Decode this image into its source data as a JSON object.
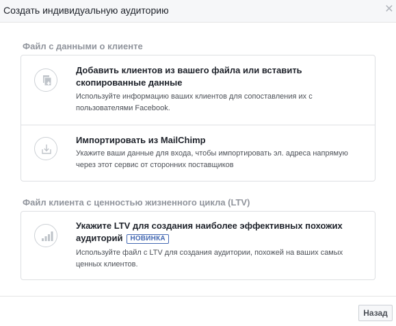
{
  "dialog": {
    "title": "Создать индивидуальную аудиторию",
    "close_icon": "close-icon"
  },
  "sections": [
    {
      "title": "Файл с данными о клиенте",
      "options": [
        {
          "icon": "copy-add-icon",
          "title": "Добавить клиентов из вашего файла или вставить скопированные данные",
          "description": "Используйте информацию ваших клиентов для сопоставления их с пользователями Facebook."
        },
        {
          "icon": "import-icon",
          "title": "Импортировать из MailChimp",
          "description": "Укажите ваши данные для входа, чтобы импортировать эл. адреса напрямую через этот сервис от сторонних поставщиков"
        }
      ]
    },
    {
      "title": "Файл клиента с ценностью жизненного цикла (LTV)",
      "options": [
        {
          "icon": "bar-chart-icon",
          "title": "Укажите LTV для создания наиболее эффективных похожих аудиторий",
          "badge": "НОВИНКА",
          "description": "Используйте файл с LTV для создания аудитории, похожей на ваших самых ценных клиентов."
        }
      ]
    }
  ],
  "footer": {
    "back_label": "Назад"
  },
  "colors": {
    "accent": "#4267b2",
    "text": "#1d2129",
    "secondary_text": "#4b4f56",
    "section_title": "#90949c",
    "border": "#dddfe2"
  }
}
